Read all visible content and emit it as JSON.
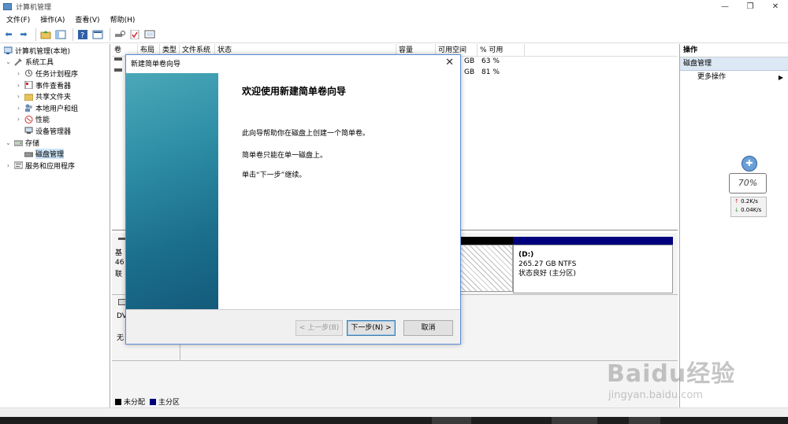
{
  "window": {
    "title": "计算机管理",
    "minimize": "—",
    "restore": "❐",
    "close": "✕"
  },
  "menu": [
    "文件(F)",
    "操作(A)",
    "查看(V)",
    "帮助(H)"
  ],
  "tree": [
    {
      "label": "计算机管理(本地)",
      "icon": "computer-management-icon",
      "level": 0,
      "arrow": "",
      "selected": false
    },
    {
      "label": "系统工具",
      "icon": "system-tools-icon",
      "level": 1,
      "arrow": "expanded",
      "selected": false
    },
    {
      "label": "任务计划程序",
      "icon": "task-scheduler-icon",
      "level": 2,
      "arrow": "collapsed",
      "selected": false
    },
    {
      "label": "事件查看器",
      "icon": "event-viewer-icon",
      "level": 2,
      "arrow": "collapsed",
      "selected": false
    },
    {
      "label": "共享文件夹",
      "icon": "shared-folders-icon",
      "level": 2,
      "arrow": "collapsed",
      "selected": false
    },
    {
      "label": "本地用户和组",
      "icon": "local-users-icon",
      "level": 2,
      "arrow": "collapsed",
      "selected": false
    },
    {
      "label": "性能",
      "icon": "performance-icon",
      "level": 2,
      "arrow": "collapsed",
      "selected": false
    },
    {
      "label": "设备管理器",
      "icon": "device-manager-icon",
      "level": 2,
      "arrow": "",
      "selected": false
    },
    {
      "label": "存储",
      "icon": "storage-icon",
      "level": 1,
      "arrow": "expanded",
      "selected": false
    },
    {
      "label": "磁盘管理",
      "icon": "disk-management-icon",
      "level": 2,
      "arrow": "",
      "selected": true
    },
    {
      "label": "服务和应用程序",
      "icon": "services-icon",
      "level": 1,
      "arrow": "collapsed",
      "selected": false
    }
  ],
  "columns": [
    "卷",
    "布局",
    "类型",
    "文件系统",
    "状态",
    "容量",
    "可用空间",
    "% 可用"
  ],
  "volumes": [
    {
      "free_unit": "GB",
      "pct": "63 %"
    },
    {
      "free_unit": "GB",
      "pct": "81 %"
    }
  ],
  "disk0": {
    "label_a": "基",
    "label_b": "46",
    "label_c": "联"
  },
  "cdrom": {
    "label_a": "DV",
    "label_b": "无"
  },
  "partition_d": {
    "name": "(D:)",
    "size": "265.27 GB NTFS",
    "status": "状态良好 (主分区)"
  },
  "legend": {
    "unallocated": "未分配",
    "primary": "主分区",
    "unallocated_color": "#000000",
    "primary_color": "#00007c"
  },
  "actions": {
    "header": "操作",
    "selected": "磁盘管理",
    "more": "更多操作"
  },
  "widget": {
    "percent": "70%",
    "upload": "0.2K/s",
    "download": "0.04K/s"
  },
  "dialog": {
    "title": "新建简单卷向导",
    "heading": "欢迎使用新建简单卷向导",
    "line1": "此向导帮助你在磁盘上创建一个简单卷。",
    "line2": "简单卷只能在单一磁盘上。",
    "line3": "单击“下一步”继续。",
    "back": "< 上一步(B)",
    "next": "下一步(N) >",
    "cancel": "取消"
  },
  "watermark": {
    "main": "Baidu经验",
    "sub": "jingyan.baidu.com"
  }
}
